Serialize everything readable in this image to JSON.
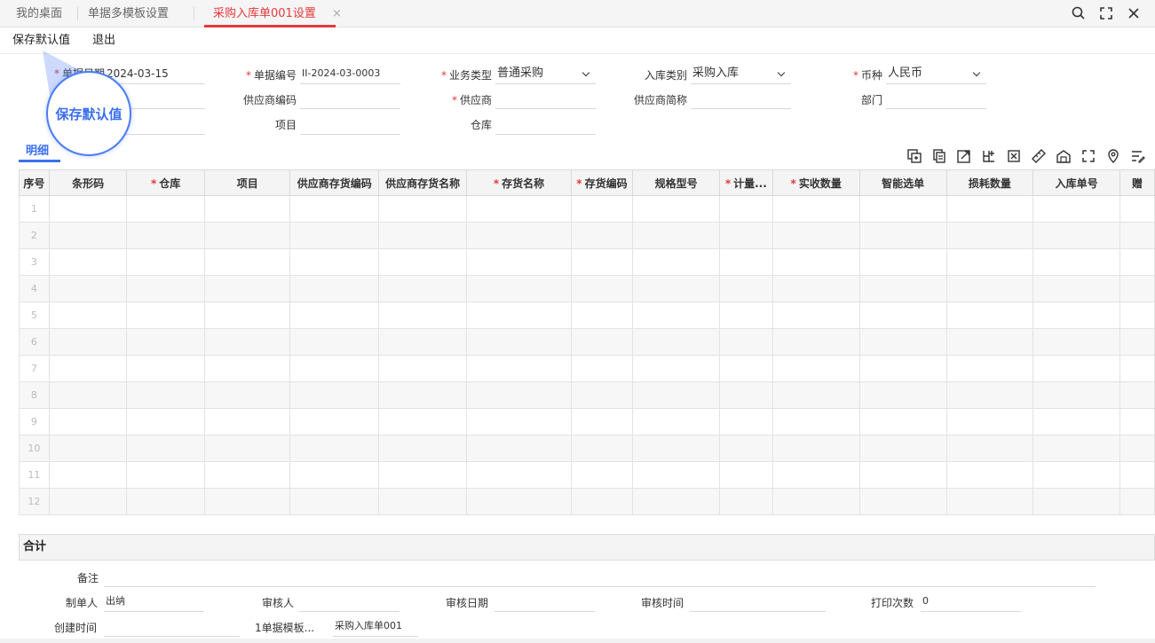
{
  "tabs": [
    {
      "label": "我的桌面",
      "active": false
    },
    {
      "label": "单据多模板设置",
      "active": false
    },
    {
      "label": "采购入库单001设置",
      "active": true
    }
  ],
  "tab_close_glyph": "×",
  "window_icons": [
    "search-icon",
    "fullscreen-icon",
    "close-icon"
  ],
  "toolbar": {
    "save_default": "保存默认值",
    "exit": "退出"
  },
  "tooltip_bubble": "保存默认值",
  "header_fields": {
    "doc_date": {
      "label": "单据日期",
      "required": true,
      "value": "2024-03-15"
    },
    "doc_no": {
      "label": "单据编号",
      "required": true,
      "value": "II-2024-03-0003"
    },
    "biz_type": {
      "label": "业务类型",
      "required": true,
      "value": "普通采购"
    },
    "in_category": {
      "label": "入库类别",
      "required": false,
      "value": "采购入库"
    },
    "currency": {
      "label": "币种",
      "required": true,
      "value": "人民币"
    },
    "rate": {
      "value": "00"
    },
    "supplier_code": {
      "label": "供应商编码",
      "value": ""
    },
    "supplier": {
      "label": "供应商",
      "required": true,
      "value": ""
    },
    "supplier_short": {
      "label": "供应商简称",
      "value": ""
    },
    "dept": {
      "label": "部门",
      "value": ""
    },
    "project": {
      "label": "项目",
      "value": ""
    },
    "warehouse": {
      "label": "仓库",
      "value": ""
    }
  },
  "detail_tab": "明细",
  "toolbar_icons": [
    "insert-row-icon",
    "copy-row-icon",
    "import-icon",
    "batch-icon",
    "excel-icon",
    "ruler-icon",
    "warehouse-icon",
    "expand-icon",
    "location-icon",
    "settings-icon"
  ],
  "grid": {
    "columns": [
      {
        "label": "序号",
        "required": false
      },
      {
        "label": "条形码",
        "required": false
      },
      {
        "label": "仓库",
        "required": true
      },
      {
        "label": "项目",
        "required": false
      },
      {
        "label": "供应商存货编码",
        "required": false
      },
      {
        "label": "供应商存货名称",
        "required": false
      },
      {
        "label": "存货名称",
        "required": true
      },
      {
        "label": "存货编码",
        "required": true
      },
      {
        "label": "规格型号",
        "required": false
      },
      {
        "label": "计量...",
        "required": true
      },
      {
        "label": "实收数量",
        "required": true
      },
      {
        "label": "智能选单",
        "required": false
      },
      {
        "label": "损耗数量",
        "required": false
      },
      {
        "label": "入库单号",
        "required": false
      },
      {
        "label": "赠",
        "required": false
      }
    ],
    "row_numbers": [
      "1",
      "2",
      "3",
      "4",
      "5",
      "6",
      "7",
      "8",
      "9",
      "10",
      "11",
      "12"
    ]
  },
  "totals_label": "合计",
  "footer": {
    "remark": {
      "label": "备注",
      "value": ""
    },
    "maker": {
      "label": "制单人",
      "value": "出纳"
    },
    "auditor": {
      "label": "审核人",
      "value": ""
    },
    "audit_date": {
      "label": "审核日期",
      "value": ""
    },
    "audit_time": {
      "label": "审核时间",
      "value": ""
    },
    "print_count": {
      "label": "打印次数",
      "value": "0"
    },
    "create_time": {
      "label": "创建时间",
      "value": ""
    },
    "template": {
      "label": "1单据模板...",
      "value": "采购入库单001"
    }
  },
  "colors": {
    "accent_red": "#e4393c",
    "accent_blue": "#3a6ff0"
  }
}
